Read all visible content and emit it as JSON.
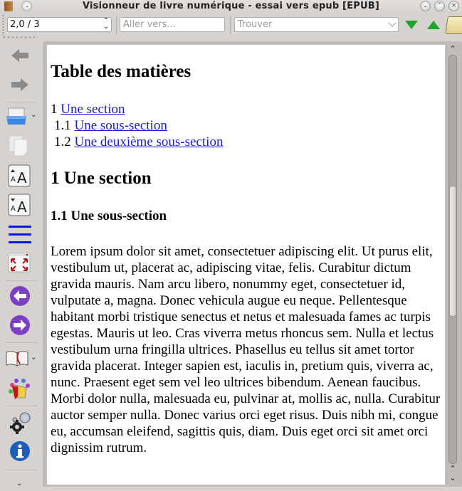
{
  "window": {
    "title": "Visionneur de livre numérique - essai vers epub [EPUB]",
    "controls": [
      "minimize",
      "maximize",
      "close"
    ]
  },
  "toolbar": {
    "position_value": "2,0 / 3",
    "goto_placeholder": "Aller vers...",
    "search_placeholder": "Trouver",
    "find_next_label": "Find next",
    "find_previous_label": "Find previous"
  },
  "sidebar": {
    "items": [
      {
        "icon": "back-arrow-icon",
        "label": "Back"
      },
      {
        "icon": "forward-arrow-icon",
        "label": "Forward"
      },
      {
        "icon": "open-folder-icon",
        "label": "Open ebook",
        "has_menu": true
      },
      {
        "icon": "copy-icon",
        "label": "Copy"
      },
      {
        "icon": "font-size-larger-icon",
        "label": "Font size larger"
      },
      {
        "icon": "font-size-smaller-icon",
        "label": "Font size smaller"
      },
      {
        "icon": "table-of-contents-icon",
        "label": "Table of contents"
      },
      {
        "icon": "fullscreen-icon",
        "label": "Full screen"
      },
      {
        "icon": "previous-page-icon",
        "label": "Previous page"
      },
      {
        "icon": "next-page-icon",
        "label": "Next page"
      },
      {
        "icon": "bookmarks-icon",
        "label": "Bookmarks",
        "has_menu": true
      },
      {
        "icon": "theme-icon",
        "label": "Themes"
      },
      {
        "icon": "preferences-icon",
        "label": "Preferences"
      },
      {
        "icon": "info-icon",
        "label": "Metadata"
      }
    ],
    "overflow_label": "More"
  },
  "content": {
    "toc_heading": "Table des matières",
    "toc": [
      {
        "number": "1",
        "label": "Une section"
      },
      {
        "number": "1.1",
        "label": "Une sous-section"
      },
      {
        "number": "1.2",
        "label": "Une deuxième sous-section"
      }
    ],
    "section_heading": "1 Une section",
    "subsection_heading": "1.1 Une sous-section",
    "paragraph": "Lorem ipsum dolor sit amet, consectetuer adipiscing elit. Ut purus elit, vestibulum ut, placerat ac, adipiscing vitae, felis. Curabitur dictum gravida mauris. Nam arcu libero, nonummy eget, consectetuer id, vulputate a, magna. Donec vehicula augue eu neque. Pellentesque habitant morbi tristique senectus et netus et malesuada fames ac turpis egestas. Mauris ut leo. Cras viverra metus rhoncus sem. Nulla et lectus vestibulum urna fringilla ultrices. Phasellus eu tellus sit amet tortor gravida placerat. Integer sapien est, iaculis in, pretium quis, viverra ac, nunc. Praesent eget sem vel leo ultrices bibendum. Aenean faucibus. Morbi dolor nulla, malesuada eu, pulvinar at, mollis ac, nulla. Curabitur auctor semper nulla. Donec varius orci eget risus. Duis nibh mi, congue eu, accumsan eleifend, sagittis quis, diam. Duis eget orci sit amet orci dignissim rutrum."
  },
  "scrollbar": {
    "position_fraction": 0.47,
    "visible_fraction": 0.32
  },
  "colors": {
    "link": "#1a1ad0",
    "accent_green": "#1fa32a",
    "toc_blue": "#0a17d8",
    "nav_purple": "#7b3fc4"
  }
}
